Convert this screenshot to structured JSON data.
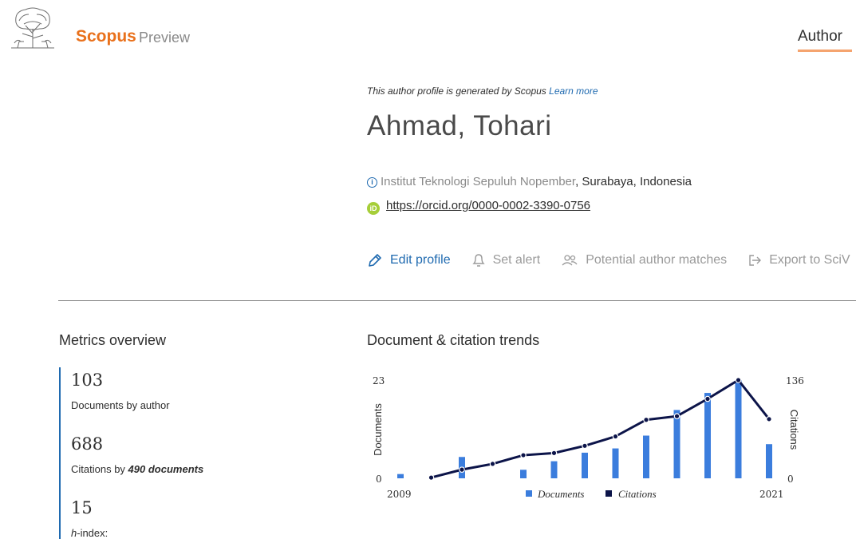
{
  "header": {
    "brand": "Scopus",
    "brand_suffix": "Preview",
    "nav_author": "Author"
  },
  "profile": {
    "generated_note": "This author profile is generated by Scopus",
    "learn_more": "Learn more",
    "name": "Ahmad, Tohari",
    "affiliation_institution": "Institut Teknologi Sepuluh Nopember",
    "affiliation_location": ", Surabaya, Indonesia",
    "orcid_badge": "iD",
    "orcid_url": "https://orcid.org/0000-0002-3390-0756"
  },
  "actions": {
    "edit_profile": "Edit profile",
    "set_alert": "Set alert",
    "potential_matches": "Potential author matches",
    "export": "Export to SciV"
  },
  "metrics": {
    "title": "Metrics overview",
    "documents_value": "103",
    "documents_label": "Documents by author",
    "citations_value": "688",
    "citations_label_prefix": "Citations by ",
    "citations_label_bold": "490 documents",
    "hindex_value": "15",
    "hindex_label_italic": "h",
    "hindex_label_rest": "-index:"
  },
  "chart_data": {
    "type": "bar+line",
    "title": "Document & citation trends",
    "ylabel_left": "Documents",
    "ylabel_right": "Citations",
    "y_left_ticks": [
      "0",
      "23"
    ],
    "y_right_ticks": [
      "0",
      "136"
    ],
    "ylim_left": [
      0,
      23
    ],
    "ylim_right": [
      0,
      136
    ],
    "x_start_label": "2009",
    "x_end_label": "2021",
    "legend": [
      "Documents",
      "Citations"
    ],
    "colors": {
      "documents": "#3b7ddd",
      "citations": "#0c1449"
    },
    "years": [
      2009,
      2010,
      2011,
      2012,
      2013,
      2014,
      2015,
      2016,
      2017,
      2018,
      2019,
      2020,
      2021
    ],
    "documents": [
      1,
      0,
      5,
      0,
      2,
      4,
      6,
      7,
      10,
      16,
      20,
      23,
      8
    ],
    "citations": [
      null,
      1,
      12,
      20,
      32,
      35,
      45,
      58,
      81,
      86,
      110,
      136,
      82
    ]
  }
}
